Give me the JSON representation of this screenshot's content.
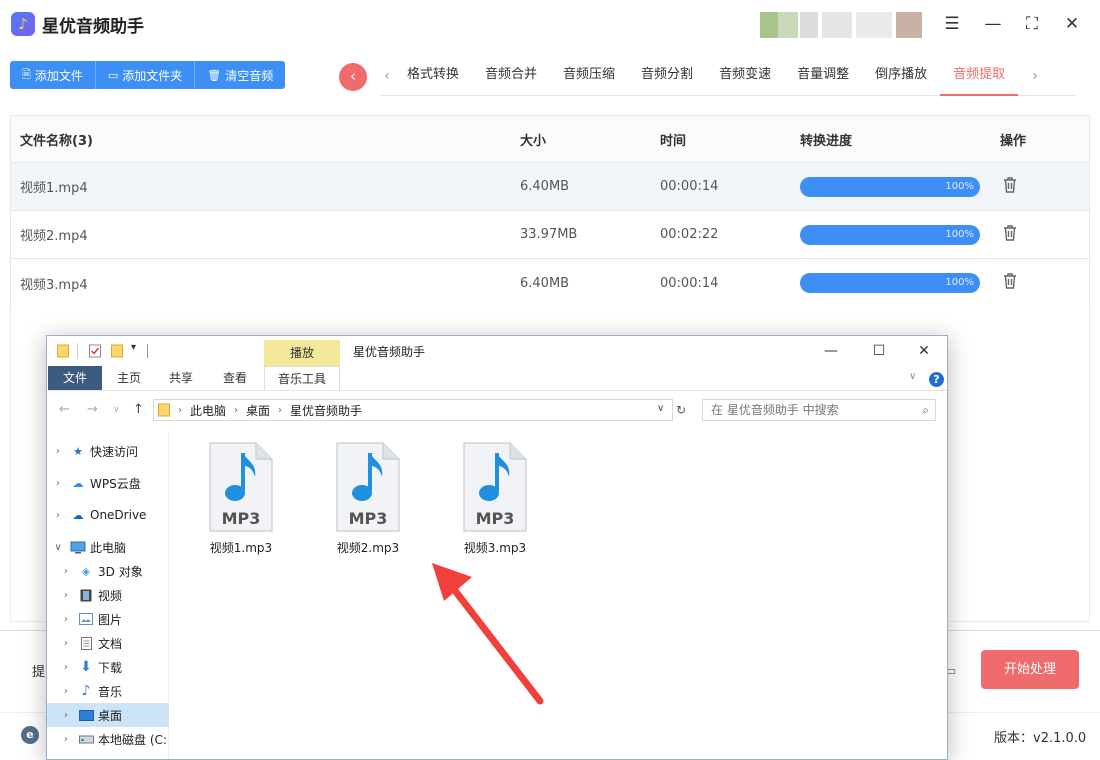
{
  "app": {
    "title": "星优音频助手"
  },
  "toolbar": {
    "add_file": "添加文件",
    "add_folder": "添加文件夹",
    "clear": "清空音频"
  },
  "tabs": [
    "格式转换",
    "音频合并",
    "音频压缩",
    "音频分割",
    "音频变速",
    "音量调整",
    "倒序播放",
    "音频提取"
  ],
  "active_tab": "音频提取",
  "table": {
    "headers": [
      "文件名称(3)",
      "大小",
      "时间",
      "转换进度",
      "操作"
    ],
    "rows": [
      {
        "name": "视频1.mp4",
        "size": "6.40MB",
        "time": "00:00:14",
        "progress": "100%"
      },
      {
        "name": "视频2.mp4",
        "size": "33.97MB",
        "time": "00:02:22",
        "progress": "100%"
      },
      {
        "name": "视频3.mp4",
        "size": "6.40MB",
        "time": "00:00:14",
        "progress": "100%"
      }
    ]
  },
  "bottom": {
    "partial_label": "提",
    "start_button": "开始处理",
    "version": "版本：v2.1.0.0"
  },
  "explorer": {
    "context_tab": "播放",
    "window_title": "星优音频助手",
    "ribbon_tabs": [
      "文件",
      "主页",
      "共享",
      "查看",
      "音乐工具"
    ],
    "address": [
      "此电脑",
      "桌面",
      "星优音频助手"
    ],
    "search_placeholder": "在 星优音频助手 中搜索",
    "nav": [
      "快速访问",
      "WPS云盘",
      "OneDrive",
      "此电脑",
      "3D 对象",
      "视频",
      "图片",
      "文档",
      "下载",
      "音乐",
      "桌面",
      "本地磁盘 (C:"
    ],
    "selected_nav": "桌面",
    "file_badge": "MP3",
    "files": [
      "视频1.mp3",
      "视频2.mp3",
      "视频3.mp3"
    ]
  },
  "colors": {
    "accent_blue": "#3d8ff5",
    "accent_red": "#f06b6b"
  }
}
